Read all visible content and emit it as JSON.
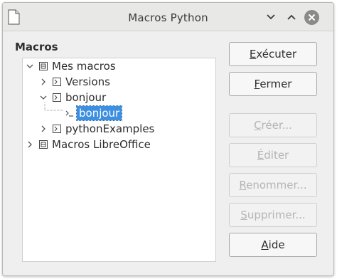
{
  "window": {
    "title": "Macros Python"
  },
  "panel": {
    "label": "Macros"
  },
  "tree": {
    "nodes": [
      {
        "label": "Mes macros"
      },
      {
        "label": "Versions"
      },
      {
        "label": "bonjour"
      },
      {
        "label": "bonjour"
      },
      {
        "label": "pythonExamples"
      },
      {
        "label": "Macros LibreOffice"
      }
    ]
  },
  "buttons": {
    "execute": {
      "accel": "E",
      "rest": "xécuter"
    },
    "close": {
      "accel": "F",
      "rest": "ermer"
    },
    "create": {
      "accel": "C",
      "rest": "réer..."
    },
    "edit": {
      "accel": "É",
      "rest": "diter"
    },
    "rename": {
      "accel": "R",
      "rest": "enommer..."
    },
    "delete": {
      "accel": "S",
      "rest": "upprimer..."
    },
    "help": {
      "accel": "A",
      "rest": "ide"
    }
  },
  "colors": {
    "selection": "#3e8fe0",
    "window_bg": "#efefef",
    "close_button": "#8a8a8a"
  }
}
